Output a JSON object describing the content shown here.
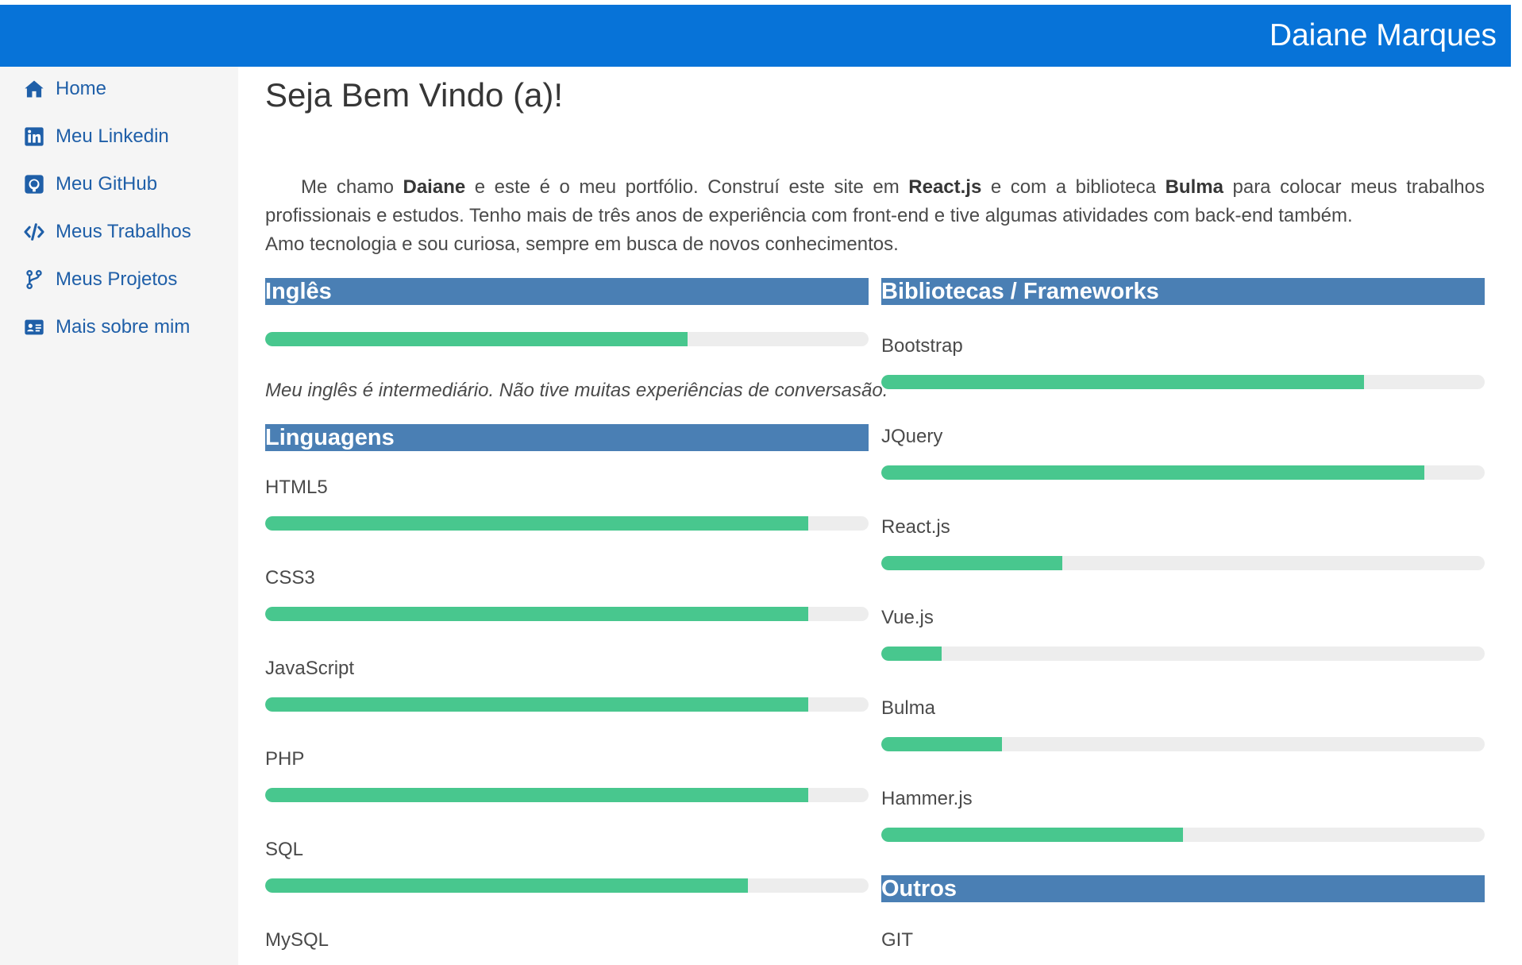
{
  "header": {
    "brand": "Daiane Marques"
  },
  "sidebar": {
    "items": [
      {
        "label": "Home",
        "icon": "home-icon"
      },
      {
        "label": "Meu Linkedin",
        "icon": "linkedin-icon"
      },
      {
        "label": "Meu GitHub",
        "icon": "github-icon"
      },
      {
        "label": "Meus Trabalhos",
        "icon": "code-icon"
      },
      {
        "label": "Meus Projetos",
        "icon": "code-branch-icon"
      },
      {
        "label": "Mais sobre mim",
        "icon": "id-card-icon"
      }
    ]
  },
  "main": {
    "title": "Seja Bem Vindo (a)!",
    "intro": {
      "part1": "Me chamo ",
      "name": "Daiane",
      "part2": " e este é o meu portfólio. Construí este site em ",
      "tech": "React.js",
      "part3": " e com a biblioteca ",
      "lib": "Bulma",
      "part4": " para colocar meus trabalhos profissionais e estudos. Tenho mais de três anos de experiência com front-end e tive algumas atividades com back-end também.",
      "line2": "Amo tecnologia e sou curiosa, sempre em busca de novos conhecimentos."
    },
    "english": {
      "title": "Inglês",
      "level": 0.7,
      "note": "Meu inglês é intermediário. Não tive muitas experiências de conversasão."
    },
    "languages": {
      "title": "Linguagens",
      "skills": [
        {
          "name": "HTML5",
          "level": 0.9
        },
        {
          "name": "CSS3",
          "level": 0.9
        },
        {
          "name": "JavaScript",
          "level": 0.9
        },
        {
          "name": "PHP",
          "level": 0.9
        },
        {
          "name": "SQL",
          "level": 0.8
        },
        {
          "name": "MySQL"
        }
      ]
    },
    "frameworks": {
      "title": "Bibliotecas / Frameworks",
      "skills": [
        {
          "name": "Bootstrap",
          "level": 0.8
        },
        {
          "name": "JQuery",
          "level": 0.9
        },
        {
          "name": "React.js",
          "level": 0.3
        },
        {
          "name": "Vue.js",
          "level": 0.1
        },
        {
          "name": "Bulma",
          "level": 0.2
        },
        {
          "name": "Hammer.js",
          "level": 0.5
        }
      ]
    },
    "others": {
      "title": "Outros",
      "skills": [
        {
          "name": "GIT"
        }
      ]
    }
  },
  "colors": {
    "header": "#0773d8",
    "section": "#4a7fb4",
    "bar_fill": "#48c78e",
    "bar_track": "#ededed",
    "link": "#1f5fa8"
  }
}
